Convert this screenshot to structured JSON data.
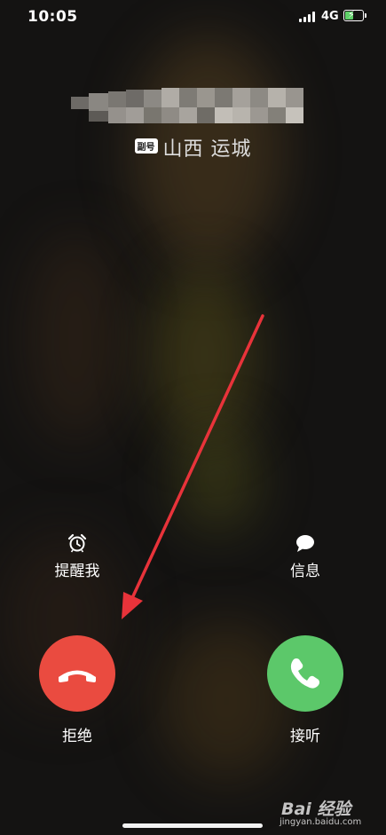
{
  "status_bar": {
    "time": "10:05",
    "network": "4G",
    "battery_charging": true
  },
  "caller": {
    "name_redacted": true,
    "sim_badge": "副号",
    "location": "山西 运城"
  },
  "actions": {
    "remind_label": "提醒我",
    "message_label": "信息"
  },
  "call_buttons": {
    "decline_label": "拒绝",
    "accept_label": "接听"
  },
  "colors": {
    "decline": "#ea4b40",
    "accept": "#5cc86a",
    "annotation_arrow": "#e8333a"
  },
  "watermark": {
    "brand": "Bai 经验",
    "url": "jingyan.baidu.com"
  }
}
